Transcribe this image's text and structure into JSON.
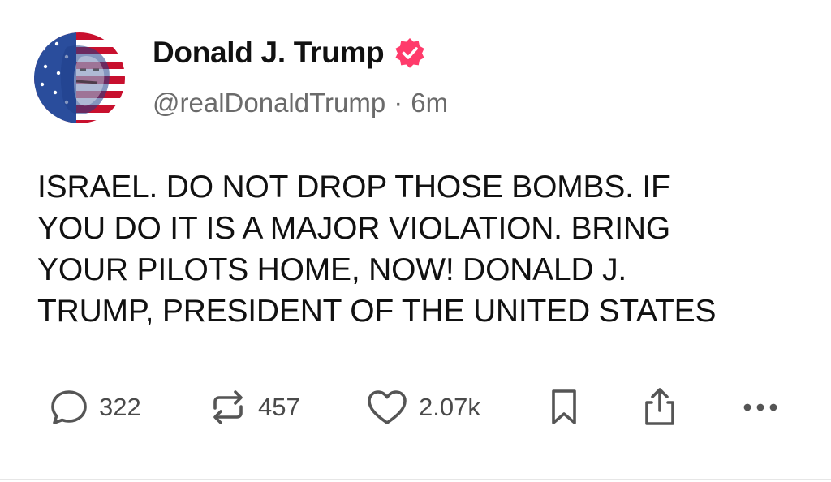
{
  "author": {
    "display_name": "Donald J. Trump",
    "handle": "@realDonaldTrump",
    "separator": "·",
    "time_ago": "6m",
    "verified_icon": "verified-badge-icon",
    "verified_color": "#ff3b6b"
  },
  "post": {
    "text": "ISRAEL. DO NOT DROP THOSE BOMBS. IF\nYOU DO IT IS A MAJOR VIOLATION. BRING\nYOUR PILOTS HOME, NOW!  DONALD J.\nTRUMP, PRESIDENT OF THE UNITED STATES"
  },
  "actions": {
    "replies": "322",
    "reposts": "457",
    "likes": "2.07k",
    "reply_icon": "reply-icon",
    "repost_icon": "repost-icon",
    "like_icon": "heart-icon",
    "bookmark_icon": "bookmark-icon",
    "share_icon": "share-icon",
    "more_icon": "more-icon"
  },
  "colors": {
    "text": "#111111",
    "muted": "#6b6b6b",
    "icon": "#555555"
  }
}
